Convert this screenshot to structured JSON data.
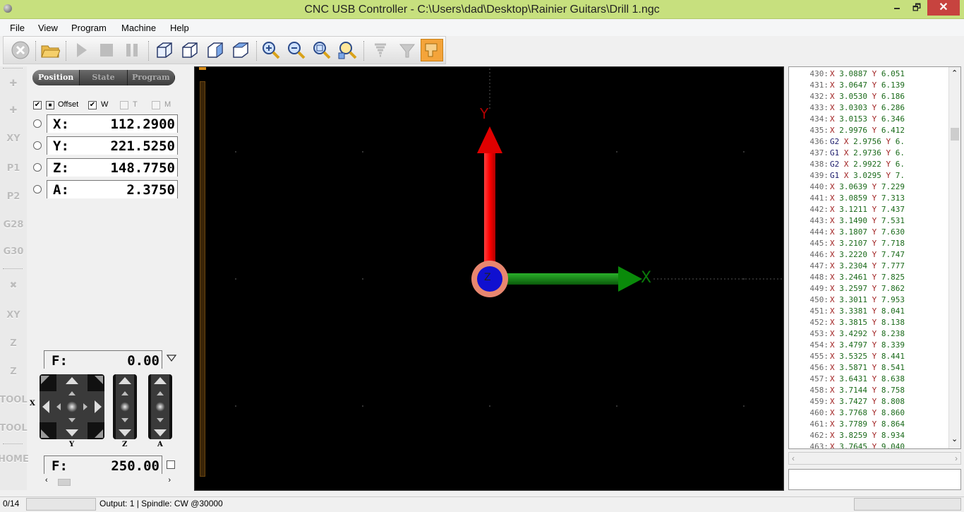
{
  "window": {
    "title": "CNC USB Controller - C:\\Users\\dad\\Desktop\\Rainier Guitars\\Drill 1.ngc",
    "minimize": "🗕",
    "maximize": "🗗",
    "close": "✕"
  },
  "menu": [
    "File",
    "View",
    "Program",
    "Machine",
    "Help"
  ],
  "toolbar": {
    "icons": [
      "stop-icon",
      "open-folder-icon",
      "play-icon",
      "stop-square-icon",
      "pause-icon",
      "view-iso-icon",
      "view-front-icon",
      "view-side-icon",
      "view-top-icon",
      "zoom-in-icon",
      "zoom-out-icon",
      "zoom-fit-icon",
      "zoom-extents-icon",
      "toolpath-icon",
      "tool-icon",
      "machine-head-icon"
    ],
    "active": "machine-head-icon"
  },
  "sidebar": {
    "buttons": [
      "✚",
      "✚",
      "XY",
      "P1",
      "P2",
      "G28",
      "G30",
      "✖",
      "XY",
      "Z",
      "Z",
      "TOOL",
      "TOOL",
      "HOME"
    ]
  },
  "tabs": [
    {
      "label": "Position",
      "active": true
    },
    {
      "label": "State",
      "active": false
    },
    {
      "label": "Program",
      "active": false
    }
  ],
  "checks": {
    "offset": "Offset",
    "w": "W",
    "t": "T",
    "m": "M",
    "check_mark": "✔"
  },
  "coords": [
    {
      "axis": "X:",
      "value": "112.2900"
    },
    {
      "axis": "Y:",
      "value": "221.5250"
    },
    {
      "axis": "Z:",
      "value": "148.7750"
    },
    {
      "axis": "A:",
      "value": "2.3750"
    }
  ],
  "feed_jog": {
    "label": "F:",
    "value": "0.00"
  },
  "feed_main": {
    "label": "F:",
    "value": "250.00"
  },
  "jog_labels": {
    "x": "X",
    "y": "Y",
    "z": "Z",
    "a": "A"
  },
  "viewport": {
    "x_axis_label": "X",
    "y_axis_label": "Y",
    "z_axis_label": "Z",
    "x_color": "#0a8a0a",
    "y_color": "#e00000",
    "z_color": "#1010d0"
  },
  "gcode": [
    {
      "n": "430:",
      "g": "",
      "x": "3.0887",
      "y": "6.051"
    },
    {
      "n": "431:",
      "g": "",
      "x": "3.0647",
      "y": "6.139"
    },
    {
      "n": "432:",
      "g": "",
      "x": "3.0530",
      "y": "6.186"
    },
    {
      "n": "433:",
      "g": "",
      "x": "3.0303",
      "y": "6.286"
    },
    {
      "n": "434:",
      "g": "",
      "x": "3.0153",
      "y": "6.346"
    },
    {
      "n": "435:",
      "g": "",
      "x": "2.9976",
      "y": "6.412"
    },
    {
      "n": "436:",
      "g": "G2",
      "x": "2.9756",
      "y": "6."
    },
    {
      "n": "437:",
      "g": "G1",
      "x": "2.9736",
      "y": "6."
    },
    {
      "n": "438:",
      "g": "G2",
      "x": "2.9922",
      "y": "6."
    },
    {
      "n": "439:",
      "g": "G1",
      "x": "3.0295",
      "y": "7."
    },
    {
      "n": "440:",
      "g": "",
      "x": "3.0639",
      "y": "7.229"
    },
    {
      "n": "441:",
      "g": "",
      "x": "3.0859",
      "y": "7.313"
    },
    {
      "n": "442:",
      "g": "",
      "x": "3.1211",
      "y": "7.437"
    },
    {
      "n": "443:",
      "g": "",
      "x": "3.1490",
      "y": "7.531"
    },
    {
      "n": "444:",
      "g": "",
      "x": "3.1807",
      "y": "7.630"
    },
    {
      "n": "445:",
      "g": "",
      "x": "3.2107",
      "y": "7.718"
    },
    {
      "n": "446:",
      "g": "",
      "x": "3.2220",
      "y": "7.747"
    },
    {
      "n": "447:",
      "g": "",
      "x": "3.2304",
      "y": "7.777"
    },
    {
      "n": "448:",
      "g": "",
      "x": "3.2461",
      "y": "7.825"
    },
    {
      "n": "449:",
      "g": "",
      "x": "3.2597",
      "y": "7.862"
    },
    {
      "n": "450:",
      "g": "",
      "x": "3.3011",
      "y": "7.953"
    },
    {
      "n": "451:",
      "g": "",
      "x": "3.3381",
      "y": "8.041"
    },
    {
      "n": "452:",
      "g": "",
      "x": "3.3815",
      "y": "8.138"
    },
    {
      "n": "453:",
      "g": "",
      "x": "3.4292",
      "y": "8.238"
    },
    {
      "n": "454:",
      "g": "",
      "x": "3.4797",
      "y": "8.339"
    },
    {
      "n": "455:",
      "g": "",
      "x": "3.5325",
      "y": "8.441"
    },
    {
      "n": "456:",
      "g": "",
      "x": "3.5871",
      "y": "8.541"
    },
    {
      "n": "457:",
      "g": "",
      "x": "3.6431",
      "y": "8.638"
    },
    {
      "n": "458:",
      "g": "",
      "x": "3.7144",
      "y": "8.758"
    },
    {
      "n": "459:",
      "g": "",
      "x": "3.7427",
      "y": "8.808"
    },
    {
      "n": "460:",
      "g": "",
      "x": "3.7768",
      "y": "8.860"
    },
    {
      "n": "461:",
      "g": "",
      "x": "3.7789",
      "y": "8.864"
    },
    {
      "n": "462:",
      "g": "",
      "x": "3.8259",
      "y": "8.934"
    },
    {
      "n": "463:",
      "g": "",
      "x": "3.7645",
      "y": "9.040"
    }
  ],
  "gcode_letters": {
    "x": "X",
    "y": "Y"
  },
  "status": {
    "progress": "0/14",
    "output": "Output: 1 | Spindle: CW @30000"
  }
}
